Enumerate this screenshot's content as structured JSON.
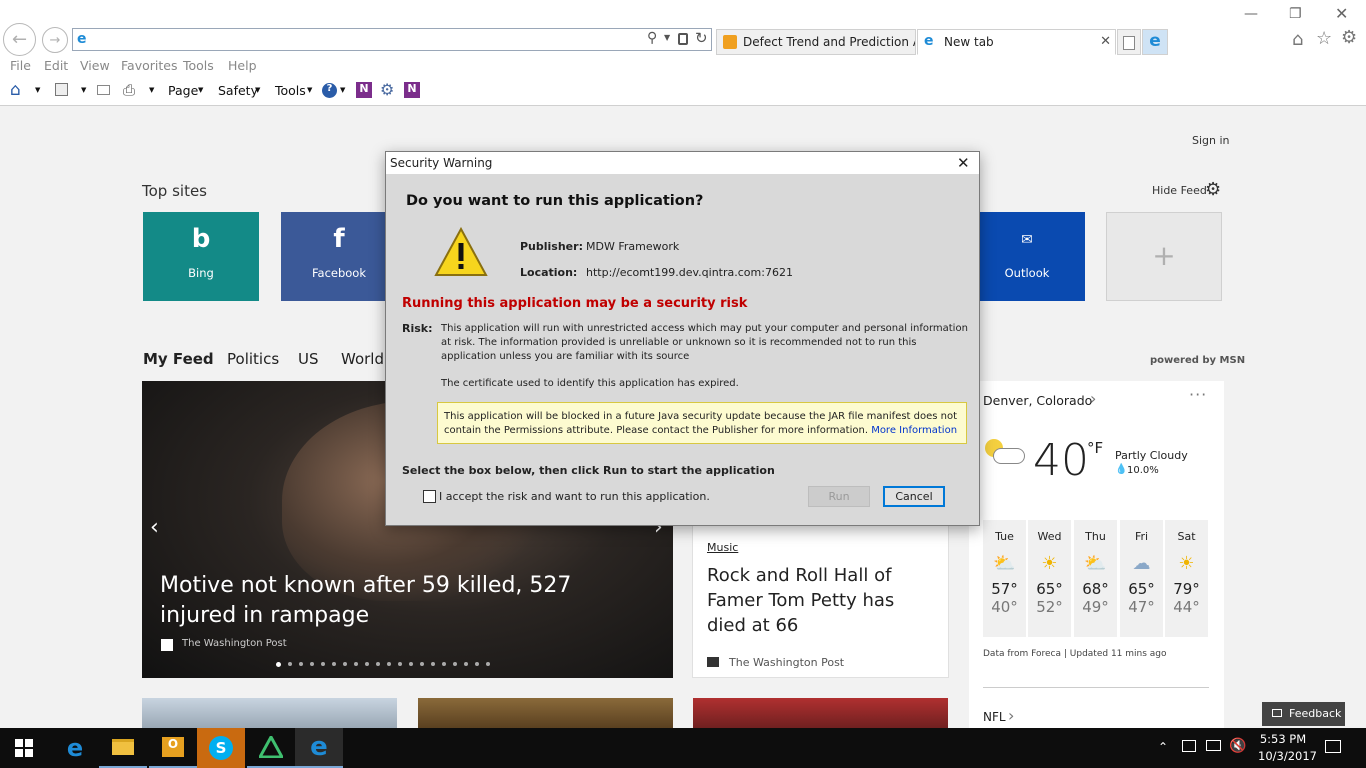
{
  "browser": {
    "address_value": "",
    "tabs": [
      {
        "label": "Defect Trend and Prediction A..."
      },
      {
        "label": "New tab"
      }
    ],
    "menu": [
      "File",
      "Edit",
      "View",
      "Favorites",
      "Tools",
      "Help"
    ],
    "toolbar": {
      "page": "Page",
      "safety": "Safety",
      "tools": "Tools"
    }
  },
  "newtab": {
    "sign_in": "Sign in",
    "top_sites_title": "Top sites",
    "hide_feed": "Hide Feed",
    "tiles": [
      {
        "label": "Bing",
        "color": "#138a87"
      },
      {
        "label": "Facebook",
        "color": "#3b5998"
      },
      {
        "label": "Outlook",
        "color": "#0a4ab0"
      },
      {
        "label": "",
        "color": "#e8e8e8"
      }
    ],
    "feed_tabs": [
      "My Feed",
      "Politics",
      "US",
      "World"
    ],
    "powered_by": "powered by MSN",
    "hero": {
      "headline": "Motive not known after 59 killed, 527 injured in rampage",
      "source": "The Washington Post"
    },
    "article": {
      "category": "Music",
      "headline": "Rock and Roll Hall of Famer Tom Petty has died at 66",
      "source": "The Washington Post"
    },
    "weather": {
      "location": "Denver, Colorado",
      "temp": "40",
      "unit": "°F",
      "condition": "Partly Cloudy",
      "precip": "10.0%",
      "forecast": [
        {
          "day": "Tue",
          "high": "57°",
          "low": "40°"
        },
        {
          "day": "Wed",
          "high": "65°",
          "low": "52°"
        },
        {
          "day": "Thu",
          "high": "68°",
          "low": "49°"
        },
        {
          "day": "Fri",
          "high": "65°",
          "low": "47°"
        },
        {
          "day": "Sat",
          "high": "79°",
          "low": "44°"
        }
      ],
      "footer": "Data from Foreca | Updated 11 mins ago"
    },
    "nfl": "NFL",
    "feedback": "Feedback"
  },
  "dialog": {
    "title": "Security Warning",
    "question": "Do you want to run this application?",
    "publisher_label": "Publisher:",
    "publisher_value": "MDW Framework",
    "location_label": "Location:",
    "location_value": "http://ecomt199.dev.qintra.com:7621",
    "risk_heading": "Running this application may be a security risk",
    "risk_label": "Risk:",
    "risk_text": "This application will run with unrestricted access which may put your computer and personal information at risk. The information provided is unreliable or unknown so it is recommended not to run this application unless you are familiar with its source",
    "cert_text": "The certificate used to identify this application has expired.",
    "notice_text": "This application will be blocked in a future Java security update because the JAR file manifest does not contain the Permissions attribute. Please contact the Publisher for more information.",
    "notice_link": "More Information",
    "instruction": "Select the box below, then click Run to start the application",
    "checkbox_label": "I accept the risk and want to run this application.",
    "run_label": "Run",
    "cancel_label": "Cancel"
  },
  "taskbar": {
    "time": "5:53 PM",
    "date": "10/3/2017"
  }
}
